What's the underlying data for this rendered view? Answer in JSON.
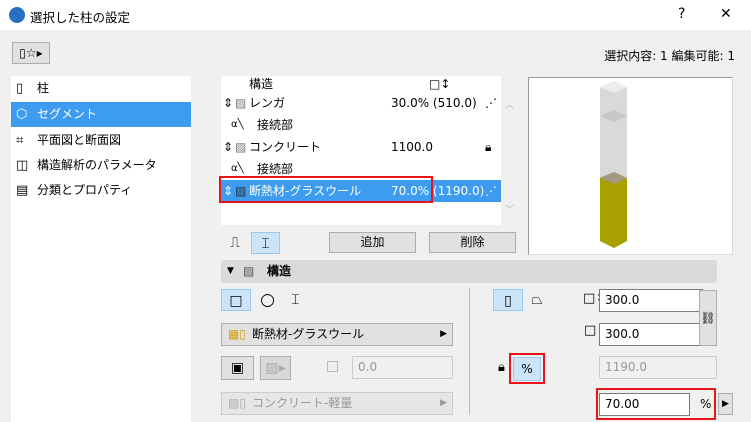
{
  "window": {
    "title": "選択した柱の設定",
    "help": "?",
    "close": "✕"
  },
  "toolbar": {
    "favorites_icon": "column-star-icon"
  },
  "selection_info": "選択内容: 1 編集可能: 1",
  "sidebar": {
    "items": [
      {
        "label": "柱",
        "icon": "column-icon"
      },
      {
        "label": "セグメント",
        "icon": "segment-icon"
      },
      {
        "label": "平面図と断面図",
        "icon": "floorplan-icon"
      },
      {
        "label": "構造解析のパラメータ",
        "icon": "structural-icon"
      },
      {
        "label": "分類とプロパティ",
        "icon": "properties-icon"
      }
    ]
  },
  "table": {
    "headers": {
      "structure": "構造",
      "height_icon": "height-icon"
    },
    "rows": [
      {
        "type": "segment",
        "name": "レンガ",
        "value": "30.0% (510.0)",
        "mode": "percent"
      },
      {
        "type": "joint",
        "name": "接続部"
      },
      {
        "type": "segment",
        "name": "コンクリート",
        "value": "1100.0",
        "mode": "locked"
      },
      {
        "type": "joint",
        "name": "接続部"
      },
      {
        "type": "segment",
        "name": "断熱材-グラスウール",
        "value": "70.0% (1190.0)",
        "mode": "percent",
        "selected": true
      }
    ],
    "add": "追加",
    "delete": "削除"
  },
  "section": {
    "title": "構造"
  },
  "form": {
    "material": "断熱材-グラスウール",
    "offset": "0.0",
    "core_material": "コンクリート-軽量",
    "width": "300.0",
    "depth": "300.0",
    "length": "1190.0",
    "percent": "70.00",
    "percent_unit": "%",
    "percent_button": "%"
  },
  "colors": {
    "accent": "#3d9cf0",
    "highlight": "#e8141a",
    "segment_fill": "#a8a000"
  }
}
